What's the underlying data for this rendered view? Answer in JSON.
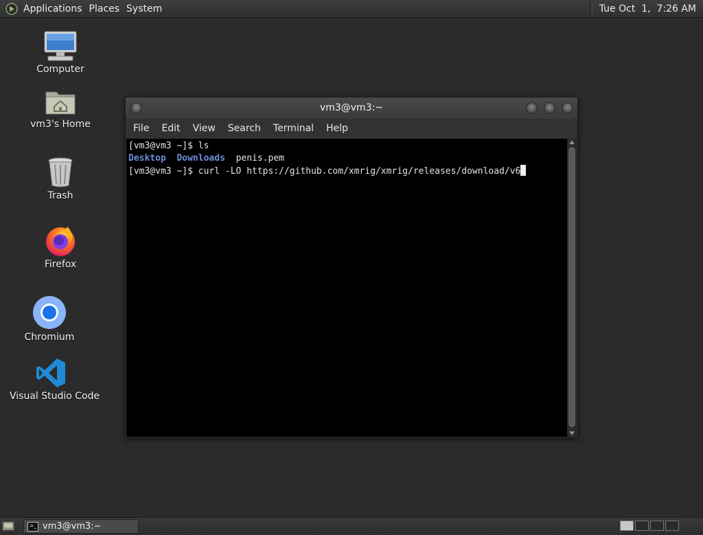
{
  "top_panel": {
    "menus": [
      "Applications",
      "Places",
      "System"
    ],
    "clock": "Tue Oct  1,  7:26 AM"
  },
  "desktop": {
    "icons": [
      {
        "label": "Computer",
        "icon": "computer-icon"
      },
      {
        "label": "vm3's Home",
        "icon": "home-folder-icon"
      },
      {
        "label": "Trash",
        "icon": "trash-icon"
      },
      {
        "label": "Firefox",
        "icon": "firefox-icon"
      },
      {
        "label": "Chromium",
        "icon": "chromium-icon"
      },
      {
        "label": "Visual Studio Code",
        "icon": "vscode-icon"
      }
    ]
  },
  "terminal": {
    "title": "vm3@vm3:~",
    "menu": [
      "File",
      "Edit",
      "View",
      "Search",
      "Terminal",
      "Help"
    ],
    "lines": {
      "l1_prompt": "[vm3@vm3 ~]$ ",
      "l1_cmd": "ls",
      "l2_dir1": "Desktop",
      "l2_dir2": "Downloads",
      "l2_file": "penis.pem",
      "l3_prompt": "[vm3@vm3 ~]$ ",
      "l3_cmd": "curl -LO https://github.com/xmrig/xmrig/releases/download/v6"
    }
  },
  "taskbar": {
    "window_button": "vm3@vm3:~"
  },
  "colors": {
    "desktop_bg": "#2b2b2b",
    "terminal_bg": "#000000",
    "directory_blue": "#6d8fd9"
  }
}
